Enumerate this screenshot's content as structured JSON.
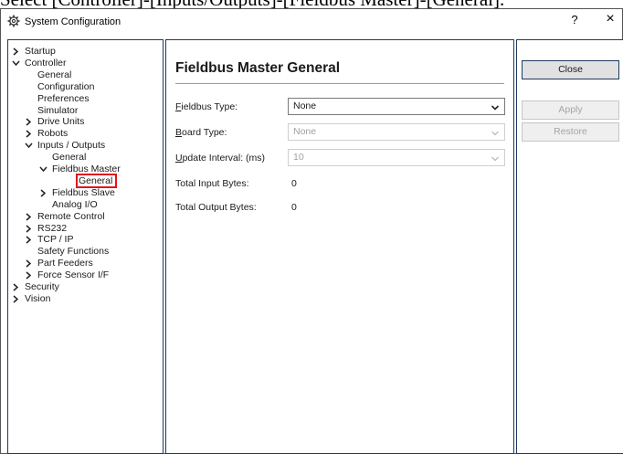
{
  "caption": "Select [Controller]-[Inputs/Outputs]-[Fieldbus Master]-[General].",
  "window": {
    "title": "System Configuration",
    "help_label": "?",
    "close_label": "×"
  },
  "tree": {
    "items": [
      {
        "label": "Startup",
        "state": "collapsed",
        "level": 0
      },
      {
        "label": "Controller",
        "state": "expanded",
        "level": 0
      },
      {
        "label": "General",
        "state": "leaf",
        "level": 1
      },
      {
        "label": "Configuration",
        "state": "leaf",
        "level": 1
      },
      {
        "label": "Preferences",
        "state": "leaf",
        "level": 1
      },
      {
        "label": "Simulator",
        "state": "leaf",
        "level": 1
      },
      {
        "label": "Drive Units",
        "state": "collapsed",
        "level": 1
      },
      {
        "label": "Robots",
        "state": "collapsed",
        "level": 1
      },
      {
        "label": "Inputs / Outputs",
        "state": "expanded",
        "level": 1
      },
      {
        "label": "General",
        "state": "leaf",
        "level": 2
      },
      {
        "label": "Fieldbus Master",
        "state": "expanded",
        "level": 2
      },
      {
        "label": "General",
        "state": "leaf",
        "level": 3,
        "selected": true
      },
      {
        "label": "Fieldbus Slave",
        "state": "collapsed",
        "level": 2
      },
      {
        "label": "Analog I/O",
        "state": "leaf",
        "level": 2
      },
      {
        "label": "Remote Control",
        "state": "collapsed",
        "level": 1
      },
      {
        "label": "RS232",
        "state": "collapsed",
        "level": 1
      },
      {
        "label": "TCP / IP",
        "state": "collapsed",
        "level": 1
      },
      {
        "label": "Safety Functions",
        "state": "leaf",
        "level": 1
      },
      {
        "label": "Part Feeders",
        "state": "collapsed",
        "level": 1
      },
      {
        "label": "Force Sensor I/F",
        "state": "collapsed",
        "level": 1
      },
      {
        "label": "Security",
        "state": "collapsed",
        "level": 0
      },
      {
        "label": "Vision",
        "state": "collapsed",
        "level": 0
      }
    ]
  },
  "panel": {
    "heading": "Fieldbus Master General",
    "fieldbus_type": {
      "mnemonic": "F",
      "rest": "ieldbus Type:",
      "value": "None"
    },
    "board_type": {
      "mnemonic": "B",
      "rest": "oard Type:",
      "value": "None"
    },
    "update_interval": {
      "mnemonic": "U",
      "rest": "pdate Interval: (ms)",
      "value": "10"
    },
    "total_input": {
      "label": "Total Input Bytes:",
      "value": "0"
    },
    "total_output": {
      "label": "Total Output Bytes:",
      "value": "0"
    }
  },
  "buttons": {
    "close": "Close",
    "apply": "Apply",
    "restore": "Restore"
  },
  "colors": {
    "selection_highlight": "#e0141e",
    "pane_border": "#1f3a5f",
    "disabled_text": "#a0a0a0"
  }
}
